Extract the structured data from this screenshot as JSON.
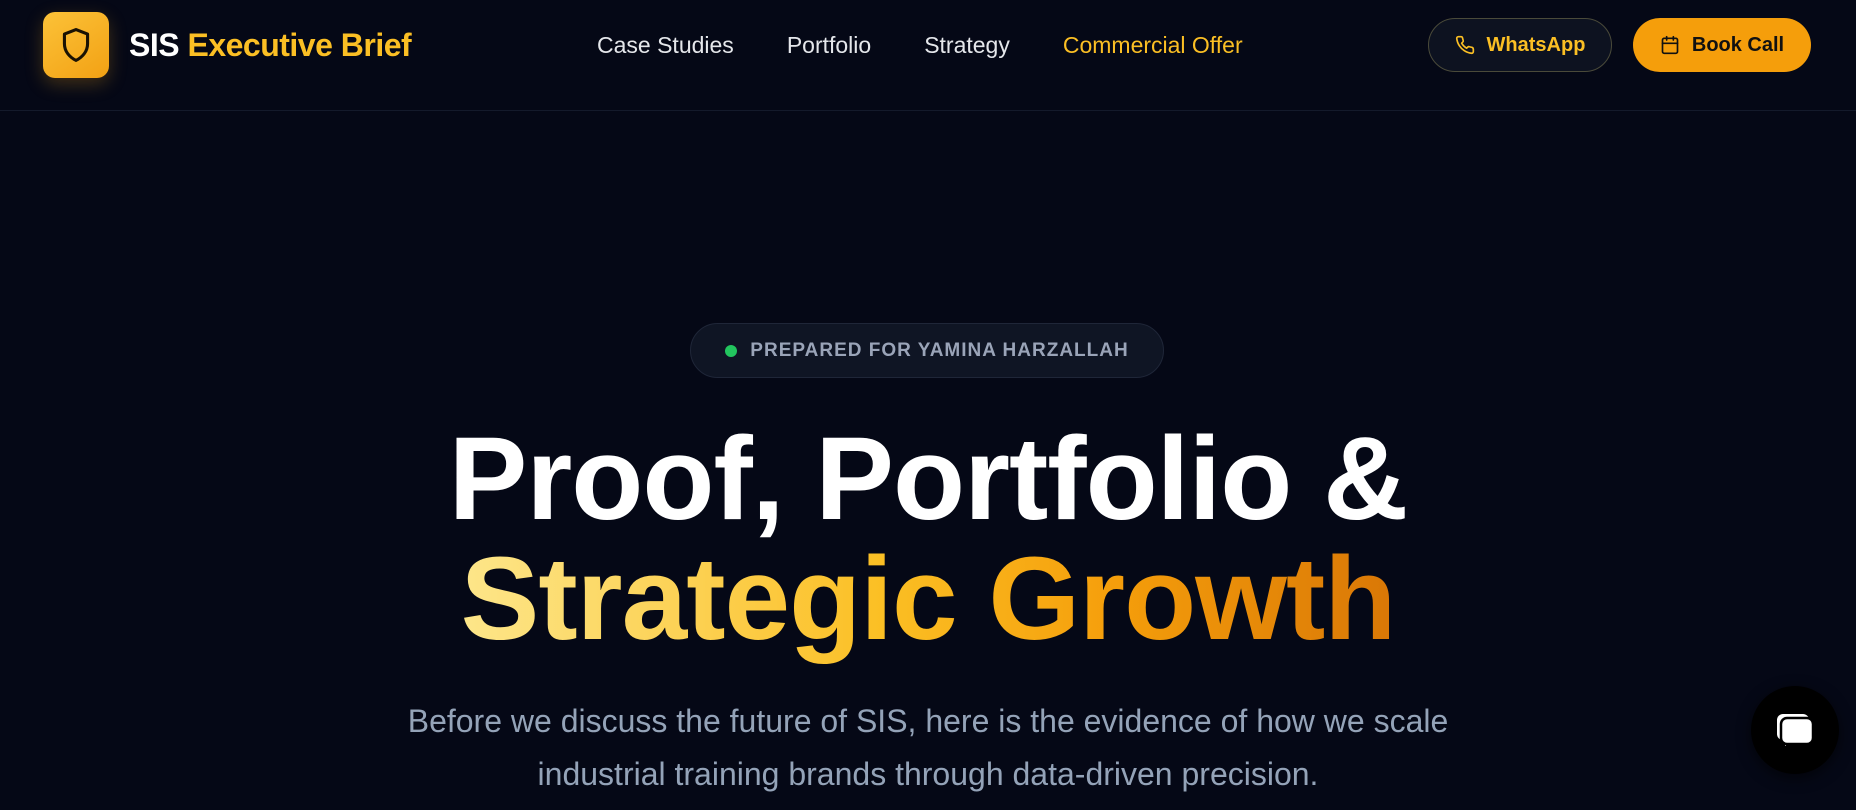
{
  "brand": {
    "name_part1": "SIS",
    "name_part2": "Executive Brief",
    "logo_icon": "shield-icon"
  },
  "nav": {
    "items": [
      {
        "label": "Case Studies"
      },
      {
        "label": "Portfolio"
      },
      {
        "label": "Strategy"
      },
      {
        "label": "Commercial Offer",
        "active": true
      }
    ]
  },
  "actions": {
    "whatsapp_label": "WhatsApp",
    "whatsapp_icon": "phone-icon",
    "book_label": "Book Call",
    "book_icon": "calendar-icon"
  },
  "hero": {
    "badge": "PREPARED FOR YAMINA HARZALLAH",
    "title_line1": "Proof, Portfolio &",
    "title_line2": "Strategic Growth",
    "subtitle_line1": "Before we discuss the future of SIS, here is the evidence of how we scale",
    "subtitle_line2": "industrial training brands through data-driven precision."
  },
  "chat": {
    "icon": "chat-bubble-icon"
  },
  "colors": {
    "background": "#050816",
    "accent": "#fbbf24",
    "accent_strong": "#f59e0b",
    "status_dot": "#22c55e"
  }
}
